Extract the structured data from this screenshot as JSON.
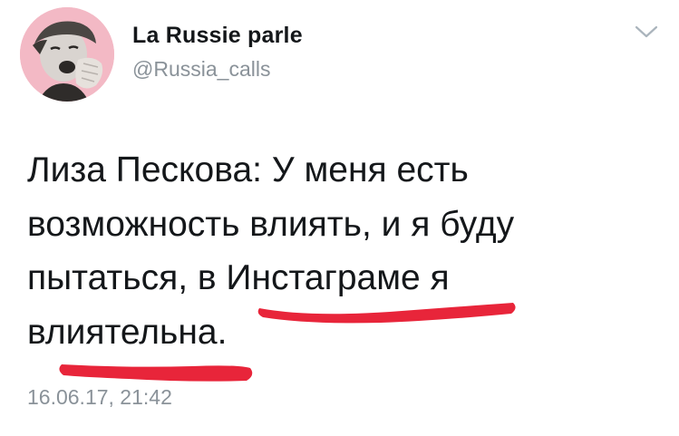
{
  "tweet": {
    "display_name": "La Russie parle",
    "handle": "@Russia_calls",
    "text_lines": [
      "Лиза Пескова: У меня есть",
      "возможность влиять, и я буду",
      "пытаться, в Инстаграме я",
      "влиятельна."
    ],
    "timestamp": "16.06.17, 21:42"
  },
  "icons": {
    "menu": "chevron-down-icon",
    "avatar": "profile-photo"
  },
  "colors": {
    "avatar_bg": "#f3b9c5",
    "name": "#14171a",
    "secondary_text": "#8a9299",
    "underline": "#e8253a"
  }
}
